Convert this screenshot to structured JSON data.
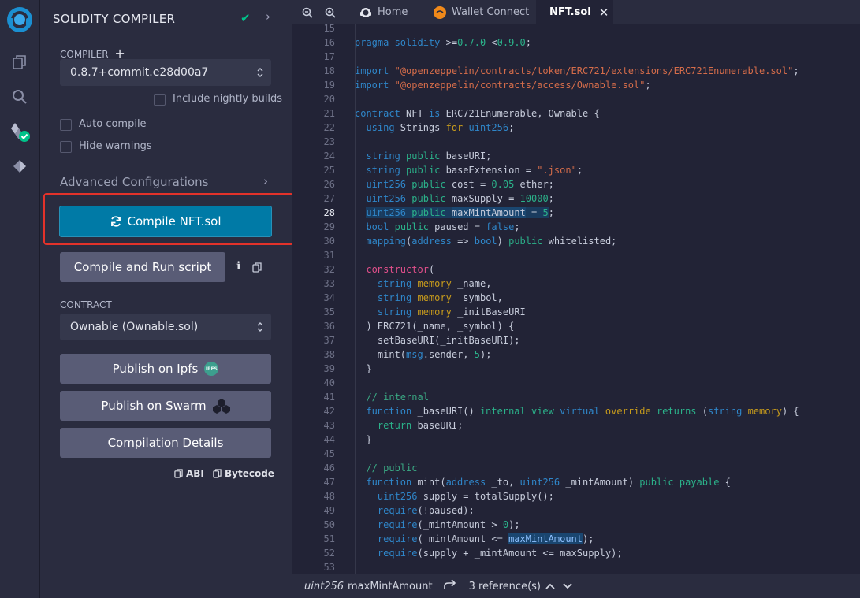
{
  "rail": {
    "icons": [
      "remix-logo-icon",
      "file-explorer-icon",
      "search-icon",
      "solidity-compiler-icon",
      "deploy-run-icon"
    ]
  },
  "panel": {
    "title": "SOLIDITY COMPILER",
    "compiler_label": "COMPILER",
    "compiler_value": "0.8.7+commit.e28d00a7",
    "nightly_label": "Include nightly builds",
    "auto_compile_label": "Auto compile",
    "hide_warnings_label": "Hide warnings",
    "advanced_label": "Advanced Configurations",
    "compile_button": "Compile NFT.sol",
    "compile_run_button": "Compile and Run script",
    "contract_label": "CONTRACT",
    "contract_value": "Ownable (Ownable.sol)",
    "publish_ipfs": "Publish on Ipfs",
    "ipfs_badge": "IPFS",
    "publish_swarm": "Publish on Swarm",
    "compilation_details": "Compilation Details",
    "abi_label": "ABI",
    "bytecode_label": "Bytecode"
  },
  "tabs": {
    "home": "Home",
    "wallet": "Wallet Connect",
    "nft": "NFT.sol"
  },
  "editor": {
    "current_line": 28,
    "lines": [
      {
        "n": "15"
      },
      {
        "n": "16"
      },
      {
        "n": "17"
      },
      {
        "n": "18"
      },
      {
        "n": "19"
      },
      {
        "n": "20"
      },
      {
        "n": "21"
      },
      {
        "n": "22"
      },
      {
        "n": "23"
      },
      {
        "n": "24"
      },
      {
        "n": "25"
      },
      {
        "n": "26"
      },
      {
        "n": "27"
      },
      {
        "n": "28"
      },
      {
        "n": "29"
      },
      {
        "n": "30"
      },
      {
        "n": "31"
      },
      {
        "n": "32"
      },
      {
        "n": "33"
      },
      {
        "n": "34"
      },
      {
        "n": "35"
      },
      {
        "n": "36"
      },
      {
        "n": "37"
      },
      {
        "n": "38"
      },
      {
        "n": "39"
      },
      {
        "n": "40"
      },
      {
        "n": "41"
      },
      {
        "n": "42"
      },
      {
        "n": "43"
      },
      {
        "n": "44"
      },
      {
        "n": "45"
      },
      {
        "n": "46"
      },
      {
        "n": "47"
      },
      {
        "n": "48"
      },
      {
        "n": "49"
      },
      {
        "n": "50"
      },
      {
        "n": "51"
      },
      {
        "n": "52"
      },
      {
        "n": "53"
      }
    ]
  },
  "status": {
    "type_name": "uint256",
    "symbol": "maxMintAmount",
    "references": "3 reference(s)"
  },
  "colors": {
    "accent": "#007aa6",
    "highlight_border": "#e3322a",
    "success": "#00c28a"
  }
}
